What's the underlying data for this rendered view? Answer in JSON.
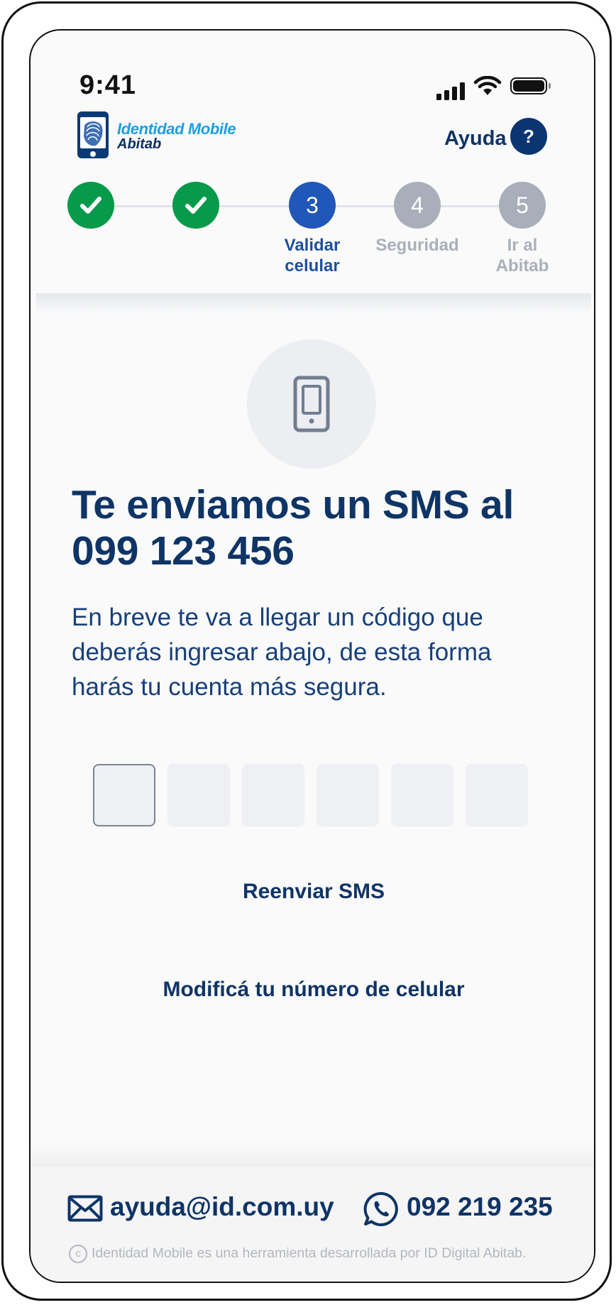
{
  "status_bar": {
    "time": "9:41"
  },
  "header": {
    "logo_line1": "Identidad Mobile",
    "logo_line2": "Abitab",
    "help_label": "Ayuda",
    "help_icon_text": "?"
  },
  "stepper": {
    "steps": [
      {
        "number": "1",
        "state": "done",
        "label": ""
      },
      {
        "number": "2",
        "state": "done",
        "label": ""
      },
      {
        "number": "3",
        "state": "active",
        "label_line1": "Validar",
        "label_line2": "celular"
      },
      {
        "number": "4",
        "state": "todo",
        "label_line1": "Seguridad",
        "label_line2": ""
      },
      {
        "number": "5",
        "state": "todo",
        "label_line1": "Ir al",
        "label_line2": "Abitab"
      }
    ]
  },
  "main": {
    "icon": "smartphone-icon",
    "headline_line1": "Te enviamos un SMS al",
    "headline_line2": "099 123 456",
    "desc_line1": "En breve te va a llegar un código que",
    "desc_line2": "deberás ingresar abajo, de esta forma",
    "desc_line3": "harás tu cuenta más segura.",
    "code_digits": [
      "",
      "",
      "",
      "",
      "",
      ""
    ],
    "resend_label": "Reenviar SMS",
    "modify_label": "Modificá tu número de celular"
  },
  "footer": {
    "email": "ayuda@id.com.uy",
    "phone": "092 219 235",
    "copyright": "Identidad Mobile es una herramienta desarrollada por ID Digital Abitab.",
    "copyright_symbol": "c"
  },
  "colors": {
    "primary_navy": "#0f3466",
    "step_done": "#079a4a",
    "step_active": "#2057b8",
    "step_todo": "#a8afba",
    "logo_blue": "#1ba0e0"
  }
}
